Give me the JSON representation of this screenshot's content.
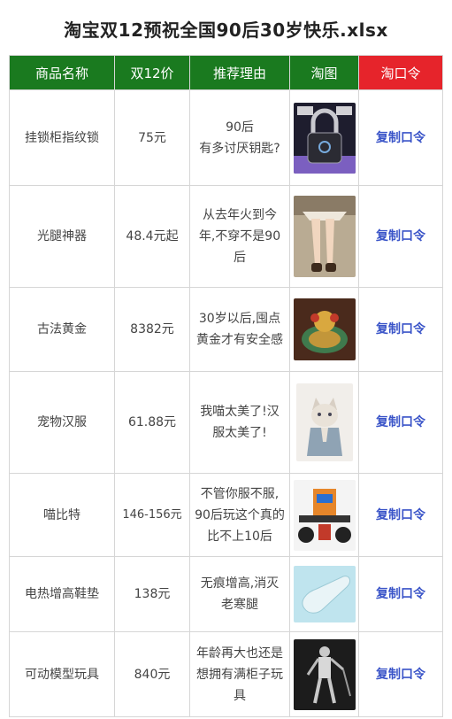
{
  "title": "淘宝双12预祝全国90后30岁快乐.xlsx",
  "headers": [
    "商品名称",
    "双12价",
    "推荐理由",
    "淘图",
    "淘口令"
  ],
  "rows": [
    {
      "name": "挂锁柜指纹锁",
      "price": "75元",
      "reason": [
        "90后",
        "有多讨厌钥匙?"
      ],
      "image": "fingerprint-padlock-image",
      "action": "复制口令"
    },
    {
      "name": "光腿神器",
      "price": "48.4元起",
      "reason": [
        "从去年火到今",
        "年,不穿不是90",
        "后"
      ],
      "image": "leggings-image",
      "action": "复制口令"
    },
    {
      "name": "古法黄金",
      "price": "8382元",
      "reason": [
        "30岁以后,囤点",
        "黄金才有安全感"
      ],
      "image": "gold-ornament-image",
      "action": "复制口令"
    },
    {
      "name": "宠物汉服",
      "price": "61.88元",
      "reason": [
        "我喵太美了!汉",
        "服太美了!"
      ],
      "image": "cat-hanfu-image",
      "action": "复制口令"
    },
    {
      "name": "喵比特",
      "price": "146-156元",
      "reason": [
        "不管你服不服,",
        "90后玩这个真的",
        "比不上10后"
      ],
      "image": "robot-kit-image",
      "action": "复制口令"
    },
    {
      "name": "电热增高鞋垫",
      "price": "138元",
      "reason": [
        "无痕增高,消灭",
        "老寒腿"
      ],
      "image": "insole-image",
      "action": "复制口令"
    },
    {
      "name": "可动模型玩具",
      "price": "840元",
      "reason": [
        "年龄再大也还是",
        "想拥有满柜子玩",
        "具"
      ],
      "image": "action-figure-image",
      "action": "复制口令"
    }
  ]
}
